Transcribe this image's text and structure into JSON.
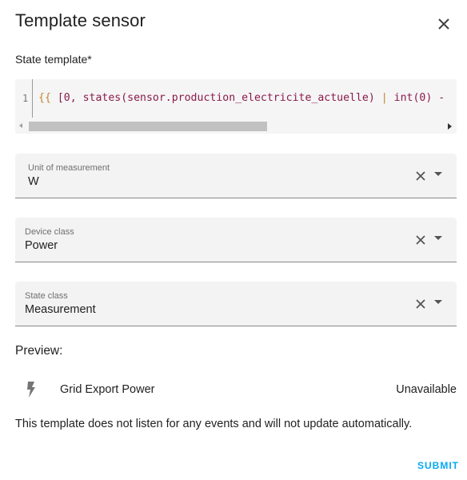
{
  "dialog": {
    "title": "Template sensor"
  },
  "state_template": {
    "label": "State template*",
    "line_number": "1",
    "code_brace": "{{",
    "code_text": " [0, states(sensor.production_electricite_actuelle) ",
    "code_pipe": "|",
    "code_tail": " int(0) -"
  },
  "fields": [
    {
      "label": "Unit of measurement",
      "value": "W"
    },
    {
      "label": "Device class",
      "value": "Power"
    },
    {
      "label": "State class",
      "value": "Measurement"
    }
  ],
  "preview": {
    "heading": "Preview:",
    "entity_name": "Grid Export Power",
    "entity_state": "Unavailable",
    "icon": "flash-icon"
  },
  "info_text": "This template does not listen for any events and will not update automatically.",
  "actions": {
    "submit_label": "SUBMIT"
  },
  "colors": {
    "accent": "#03a9f4",
    "field_bg": "#f3f3f3",
    "code_brace": "#c2862d",
    "code_text": "#8a1a4a"
  }
}
